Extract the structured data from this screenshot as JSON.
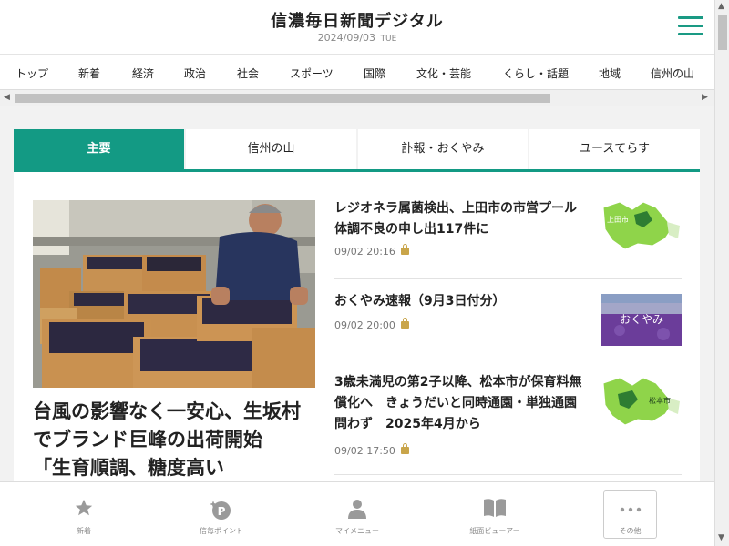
{
  "header": {
    "logo": "信濃毎日新聞デジタル",
    "date": "2024/09/03",
    "weekday": "TUE"
  },
  "nav": {
    "categories": [
      "トップ",
      "新着",
      "経済",
      "政治",
      "社会",
      "スポーツ",
      "国際",
      "文化・芸能",
      "くらし・話題",
      "地域",
      "信州の山"
    ]
  },
  "tabs": [
    "主要",
    "信州の山",
    "訃報・おくやみ",
    "ユースてらす"
  ],
  "lead": {
    "title": "台風の影響なく一安心、生坂村でブランド巨峰の出荷開始　「生育順調、糖度高い"
  },
  "news": [
    {
      "title": "レジオネラ属菌検出、上田市の市営プール　体調不良の申し出117件に",
      "time": "09/02 20:16",
      "thumb_label": "上田市",
      "paid": true
    },
    {
      "title": "おくやみ速報（9月3日付分）",
      "time": "09/02 20:00",
      "thumb_label": "おくやみ",
      "paid": true
    },
    {
      "title": "3歳未満児の第2子以降、松本市が保育料無償化へ　きょうだいと同時通園・単独通園問わず　2025年4月から",
      "time": "09/02 17:50",
      "thumb_label": "松本市",
      "paid": true
    }
  ],
  "bottom_nav": [
    {
      "label": "新着",
      "icon": "star-icon"
    },
    {
      "label": "信毎ポイント",
      "icon": "points-icon"
    },
    {
      "label": "マイメニュー",
      "icon": "person-icon"
    },
    {
      "label": "紙面ビューアー",
      "icon": "book-icon"
    },
    {
      "label": "その他",
      "icon": "more-icon"
    }
  ],
  "colors": {
    "accent": "#139a84",
    "lock": "#c9a54a",
    "map_green": "#8fd44a",
    "okuyami_purple": "#6b3d9a"
  }
}
